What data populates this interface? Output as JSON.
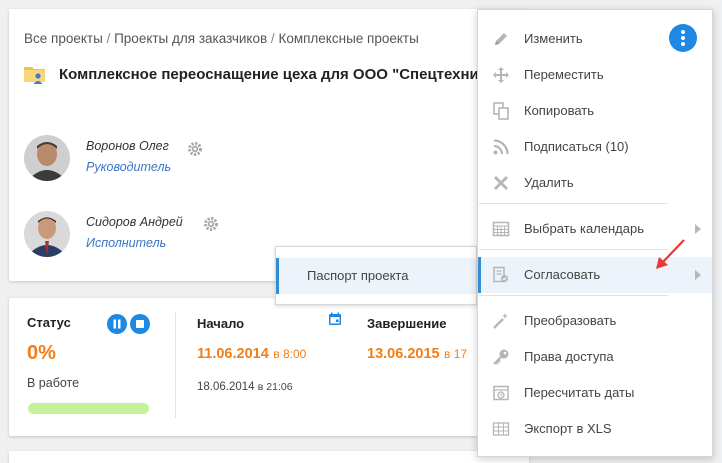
{
  "breadcrumb": [
    "Все проекты",
    "Проекты для заказчиков",
    "Комплексные проекты"
  ],
  "breadcrumb_sep": "/",
  "project": {
    "title": "Комплексное переоснащение цеха для ООО \"Спецтехни"
  },
  "people": [
    {
      "name": "Воронов Олег",
      "role": "Руководитель"
    },
    {
      "name": "Сидоров Андрей",
      "role": "Исполнитель"
    }
  ],
  "approve_submenu": {
    "items": [
      {
        "label": "Паспорт проекта"
      }
    ]
  },
  "status": {
    "label": "Статус",
    "percent": "0%",
    "state": "В работе",
    "progress": 0,
    "start": {
      "label": "Начало",
      "date": "11.06.2014",
      "time": "в 8:00",
      "created": "18.06.2014",
      "created_time": "в 21:06"
    },
    "end": {
      "label": "Завершение",
      "date": "13.06.2015",
      "time": "в 17"
    }
  },
  "menu": {
    "items": [
      {
        "label": "Изменить",
        "icon": "pencil-icon"
      },
      {
        "label": "Переместить",
        "icon": "move-icon"
      },
      {
        "label": "Копировать",
        "icon": "copy-icon"
      },
      {
        "label": "Подписаться (10)",
        "icon": "rss-icon"
      },
      {
        "label": "Удалить",
        "icon": "close-icon"
      },
      {
        "label": "Выбрать календарь",
        "icon": "calendar-grid-icon",
        "submenu": true
      },
      {
        "label": "Согласовать",
        "icon": "approve-icon",
        "submenu": true,
        "active": true
      },
      {
        "label": "Преобразовать",
        "icon": "magic-wand-icon"
      },
      {
        "label": "Права доступа",
        "icon": "key-icon"
      },
      {
        "label": "Пересчитать даты",
        "icon": "recalc-icon"
      },
      {
        "label": "Экспорт в XLS",
        "icon": "table-icon"
      }
    ]
  },
  "colors": {
    "accent": "#1e88e5",
    "orange": "#f07e1a",
    "link": "#3a75c4",
    "progress": "#c6f19b",
    "arrow": "#e53935"
  }
}
